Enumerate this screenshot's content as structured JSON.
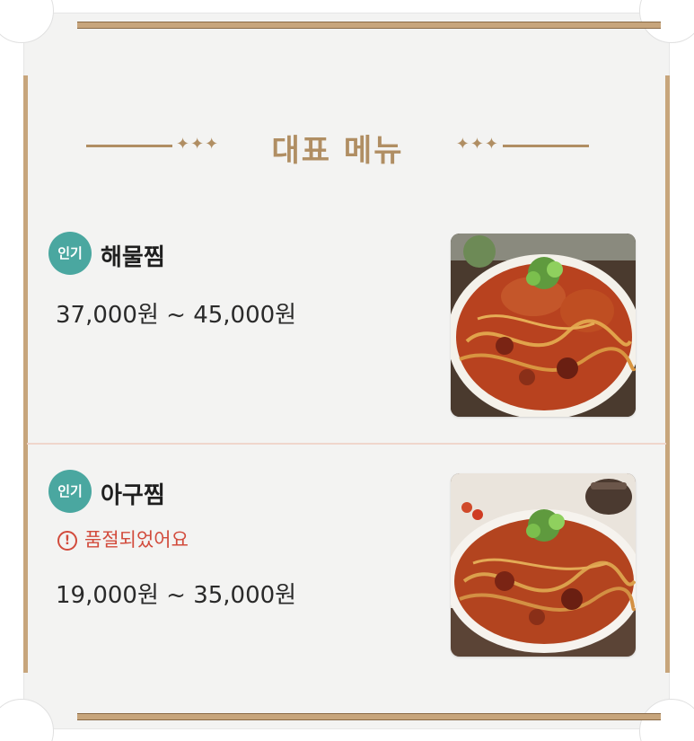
{
  "header": {
    "title": "대표 메뉴",
    "ornament_left": "⁂",
    "ornament_right": "⁂"
  },
  "menu": {
    "items": [
      {
        "badge": "인기",
        "name": "해물찜",
        "price": "37,000원 ~ 45,000원",
        "sold_out": false,
        "image_icon": "seafood-stew-photo"
      },
      {
        "badge": "인기",
        "name": "아구찜",
        "status_text": "품절되었어요",
        "status_icon_glyph": "!",
        "sold_out": true,
        "price": "19,000원 ~ 35,000원",
        "image_icon": "monkfish-stew-photo"
      }
    ]
  },
  "colors": {
    "accent_gold": "#b08e63",
    "badge_teal": "#4aa7a0",
    "soldout_red": "#d24b3c",
    "card_bg": "#f3f3f2"
  }
}
